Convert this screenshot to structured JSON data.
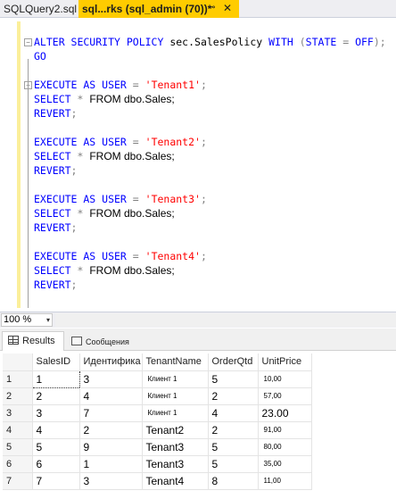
{
  "tabs": {
    "inactive_label": "SQLQuery2.sql",
    "active_label": "sql...rks (sql_admin (70))*",
    "pin_glyph": "⊸",
    "close_glyph": "✕"
  },
  "editor": {
    "lines": [
      {
        "id": "l1",
        "parts": [
          [
            "kw",
            "ALTER SECURITY POLICY "
          ],
          [
            "id",
            "sec.SalesPolicy "
          ],
          [
            "kw",
            "WITH "
          ],
          [
            "op",
            "("
          ],
          [
            "kw",
            "STATE "
          ],
          [
            "op",
            "= "
          ],
          [
            "kw",
            "OFF"
          ],
          [
            "op",
            ");"
          ]
        ]
      },
      {
        "id": "l2",
        "parts": [
          [
            "kw",
            "GO"
          ]
        ]
      },
      {
        "id": "l3",
        "parts": [
          [
            "kw",
            "EXECUTE AS USER "
          ],
          [
            "op",
            "= "
          ],
          [
            "str",
            "'Tenant1'"
          ],
          [
            "op",
            ";"
          ]
        ]
      },
      {
        "id": "l4",
        "parts": [
          [
            "kw",
            "SELECT "
          ],
          [
            "op",
            "* "
          ],
          [
            "prop",
            "FROM dbo.Sales;"
          ]
        ]
      },
      {
        "id": "l5",
        "parts": [
          [
            "kw",
            "REVERT"
          ],
          [
            "op",
            ";"
          ]
        ]
      },
      {
        "id": "l6",
        "parts": [
          [
            "kw",
            "EXECUTE AS USER "
          ],
          [
            "op",
            "= "
          ],
          [
            "str",
            "'Tenant2'"
          ],
          [
            "op",
            ";"
          ]
        ]
      },
      {
        "id": "l7",
        "parts": [
          [
            "kw",
            "SELECT "
          ],
          [
            "op",
            "* "
          ],
          [
            "prop",
            "FROM dbo.Sales;"
          ]
        ]
      },
      {
        "id": "l8",
        "parts": [
          [
            "kw",
            "REVERT"
          ],
          [
            "op",
            ";"
          ]
        ]
      },
      {
        "id": "l9",
        "parts": [
          [
            "kw",
            "EXECUTE AS USER "
          ],
          [
            "op",
            "= "
          ],
          [
            "str",
            "'Tenant3'"
          ],
          [
            "op",
            ";"
          ]
        ]
      },
      {
        "id": "l10",
        "parts": [
          [
            "kw",
            "SELECT "
          ],
          [
            "op",
            "* "
          ],
          [
            "prop",
            "FROM dbo.Sales;"
          ]
        ]
      },
      {
        "id": "l11",
        "parts": [
          [
            "kw",
            "REVERT"
          ],
          [
            "op",
            ";"
          ]
        ]
      },
      {
        "id": "l12",
        "parts": [
          [
            "kw",
            "EXECUTE AS USER "
          ],
          [
            "op",
            "= "
          ],
          [
            "str",
            "'Tenant4'"
          ],
          [
            "op",
            ";"
          ]
        ]
      },
      {
        "id": "l13",
        "parts": [
          [
            "kw",
            "SELECT "
          ],
          [
            "op",
            "* "
          ],
          [
            "prop",
            "FROM dbo.Sales;"
          ]
        ]
      },
      {
        "id": "l14",
        "parts": [
          [
            "kw",
            "REVERT"
          ],
          [
            "op",
            ";"
          ]
        ]
      }
    ],
    "outline_glyph": "−"
  },
  "zoom": {
    "value": "100 %",
    "arrow": "▾"
  },
  "results_tabs": {
    "results_label": "Results",
    "messages_label": "Сообщения"
  },
  "grid": {
    "columns": [
      "",
      "SalesID",
      "Идентифика",
      "TenantName",
      "OrderQtd",
      "UnitPrice"
    ],
    "rows": [
      [
        "1",
        "1",
        "3",
        "Клиент 1",
        "5",
        "10,00"
      ],
      [
        "2",
        "2",
        "4",
        "Клиент 1",
        "2",
        "57,00"
      ],
      [
        "3",
        "3",
        "7",
        "Клиент 1",
        "4",
        "23.00"
      ],
      [
        "4",
        "4",
        "2",
        "Tenant2",
        "2",
        "91,00"
      ],
      [
        "5",
        "5",
        "9",
        "Tenant3",
        "5",
        "80,00"
      ],
      [
        "6",
        "6",
        "1",
        "Tenant3",
        "5",
        "35,00"
      ],
      [
        "7",
        "7",
        "3",
        "Tenant4",
        "8",
        "11,00"
      ]
    ]
  }
}
